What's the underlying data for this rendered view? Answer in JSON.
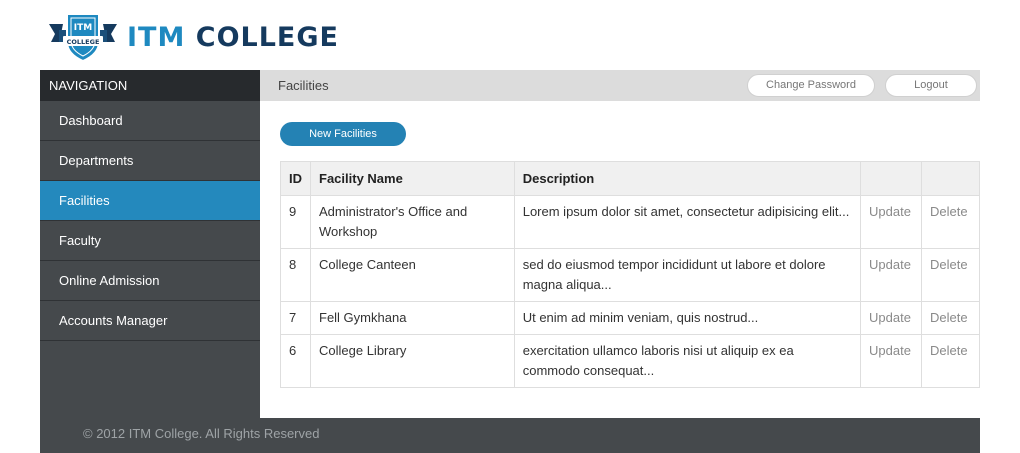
{
  "brand": {
    "badge_top": "ITM",
    "badge_bottom": "COLLEGE",
    "name_part1": "ITM",
    "name_part2": "COLLEGE",
    "primary_color": "#1e89c0",
    "dark_color": "#153a5e"
  },
  "sidebar": {
    "title": "NAVIGATION",
    "items": [
      {
        "label": "Dashboard",
        "active": false
      },
      {
        "label": "Departments",
        "active": false
      },
      {
        "label": "Facilities",
        "active": true
      },
      {
        "label": "Faculty",
        "active": false
      },
      {
        "label": "Online Admission",
        "active": false
      },
      {
        "label": "Accounts Manager",
        "active": false
      }
    ]
  },
  "topbar": {
    "crumb": "Facilities",
    "change_password_label": "Change Password",
    "logout_label": "Logout"
  },
  "main": {
    "new_button_label": "New Facilities",
    "table": {
      "headers": [
        "ID",
        "Facility Name",
        "Description",
        "",
        ""
      ],
      "rows": [
        {
          "id": "9",
          "name": "Administrator's Office and Workshop",
          "description": "Lorem ipsum dolor sit amet, consectetur adipisicing elit...",
          "update": "Update",
          "delete": "Delete"
        },
        {
          "id": "8",
          "name": "College Canteen",
          "description": "sed do eiusmod tempor incididunt ut labore et dolore magna aliqua...",
          "update": "Update",
          "delete": "Delete"
        },
        {
          "id": "7",
          "name": "Fell Gymkhana",
          "description": "Ut enim ad minim veniam, quis nostrud...",
          "update": "Update",
          "delete": "Delete"
        },
        {
          "id": "6",
          "name": "College Library",
          "description": "exercitation ullamco laboris nisi ut aliquip ex ea commodo consequat...",
          "update": "Update",
          "delete": "Delete"
        }
      ]
    }
  },
  "footer": {
    "text": "© 2012 ITM College. All Rights Reserved"
  },
  "colors": {
    "sidebar_bg": "#45494c",
    "active_item": "#2489bd",
    "nav_title_bg": "#272a2d",
    "button_blue": "#2482b4"
  }
}
